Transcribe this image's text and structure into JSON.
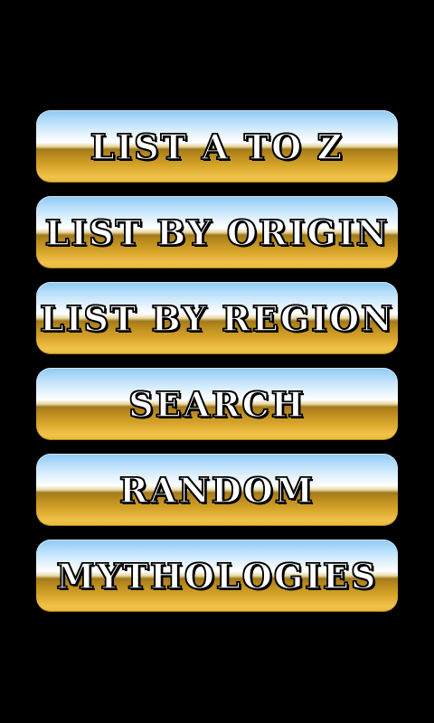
{
  "menu": {
    "buttons": [
      {
        "label": "LIST A TO Z"
      },
      {
        "label": "LIST BY ORIGIN"
      },
      {
        "label": "LIST BY REGION"
      },
      {
        "label": "SEARCH"
      },
      {
        "label": "RANDOM"
      },
      {
        "label": "MYTHOLOGIES"
      }
    ]
  },
  "colors": {
    "background": "#000000",
    "button_top": "#8cc8f4",
    "button_bottom": "#e8b93c",
    "label_fill": "#ffffff",
    "label_outline": "#000000"
  }
}
